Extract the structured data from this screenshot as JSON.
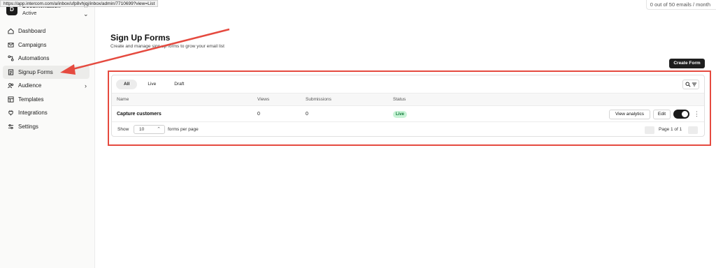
{
  "browser": {
    "status_url": "https://app.intercom.com/a/inbox/ufp8vhjqj/inbox/admin/7710699?view=List"
  },
  "workspace": {
    "avatar_letter": "D",
    "name": "Documentation",
    "status": "Active"
  },
  "sidebar": {
    "items": [
      {
        "label": "Dashboard",
        "icon": "home-icon"
      },
      {
        "label": "Campaigns",
        "icon": "mail-icon"
      },
      {
        "label": "Automations",
        "icon": "automation-icon"
      },
      {
        "label": "Signup Forms",
        "icon": "form-icon",
        "active": true
      },
      {
        "label": "Audience",
        "icon": "users-icon"
      },
      {
        "label": "Templates",
        "icon": "template-icon"
      },
      {
        "label": "Integrations",
        "icon": "plug-icon"
      },
      {
        "label": "Settings",
        "icon": "sliders-icon"
      }
    ]
  },
  "topbar": {
    "quota": "0 out of 50 emails / month"
  },
  "page": {
    "title": "Sign Up Forms",
    "subtitle": "Create and manage sign up forms to grow your email list",
    "create_button": "Create Form"
  },
  "tabs": [
    "All",
    "Live",
    "Draft"
  ],
  "table": {
    "columns": [
      "Name",
      "Views",
      "Submissions",
      "Status"
    ],
    "rows": [
      {
        "name": "Capture customers",
        "views": "0",
        "submissions": "0",
        "status": "Live",
        "analytics_label": "View analytics",
        "edit_label": "Edit",
        "enabled": true
      }
    ]
  },
  "pagination": {
    "show_label": "Show",
    "per_page": "10",
    "per_page_label": "forms per page",
    "page_label": "Page 1 of 1"
  },
  "colors": {
    "accent": "#1e1e1e",
    "annotation": "#e54a3f",
    "live_badge_bg": "#c8f3d6",
    "live_badge_text": "#117a3a"
  }
}
